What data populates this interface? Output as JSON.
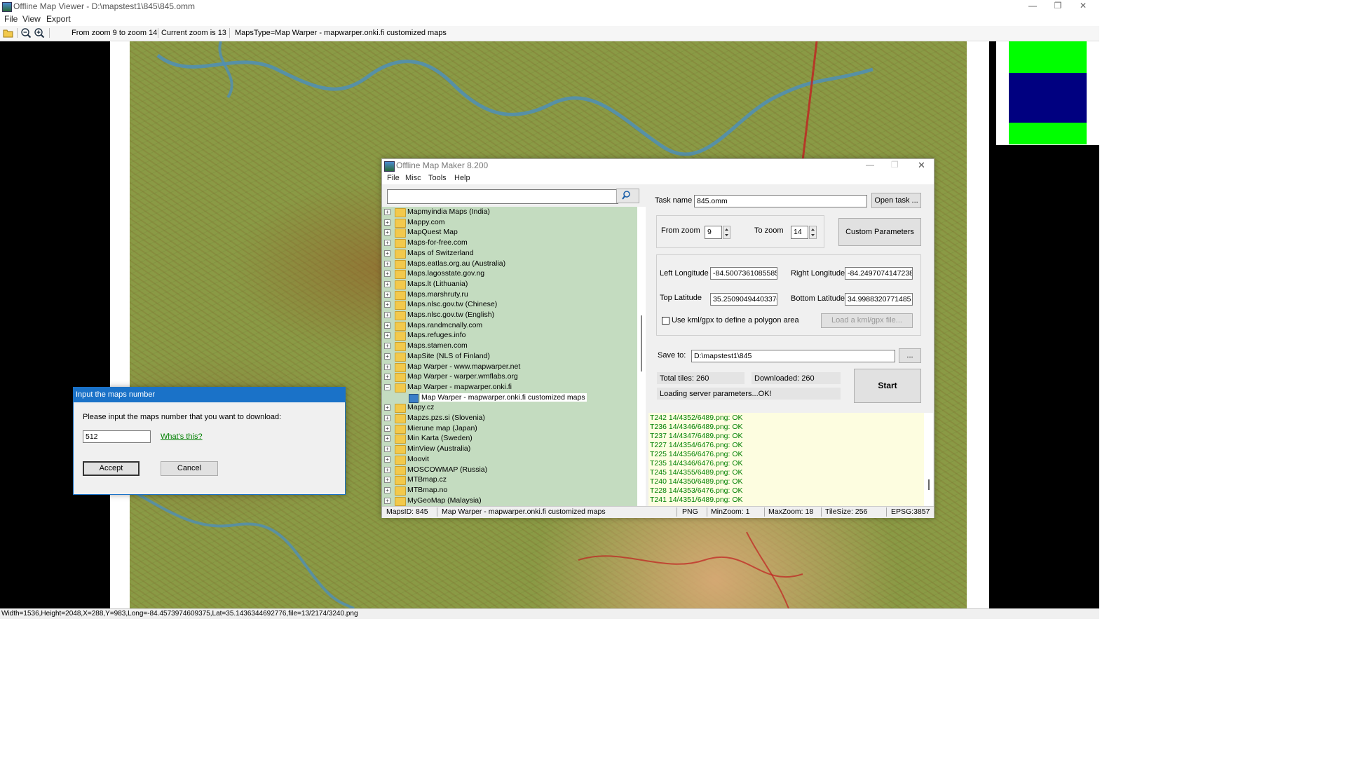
{
  "titlebar": {
    "title": "Offline Map Viewer - D:\\mapstest1\\845\\845.omm",
    "minimize": "—",
    "maximize": "❐",
    "close": "✕"
  },
  "menubar": {
    "items": [
      "File",
      "View",
      "Export"
    ]
  },
  "toolbar": {
    "icons": [
      "open-folder-icon",
      "zoom-out-icon",
      "zoom-in-icon"
    ],
    "zoom_range": "From zoom 9 to zoom 14",
    "current_zoom": "Current zoom is 13",
    "maps_type": "MapsType=Map Warper - mapwarper.onki.fi customized maps"
  },
  "statusbar": {
    "text": "Width=1536,Height=2048,X=288,Y=983,Long=-84.4573974609375,Lat=35.1436344692776,file=13/2174/3240.png"
  },
  "thumbnail": {
    "colors": [
      "#00ff00",
      "#000080",
      "#00ff00"
    ]
  },
  "omm": {
    "title": "Offline Map Maker 8.200",
    "menu": [
      "File",
      "Misc",
      "Tools",
      "Help"
    ],
    "search_placeholder": "",
    "tree": [
      {
        "label": "Mapmyindia Maps (India)",
        "expanded": false
      },
      {
        "label": "Mappy.com",
        "expanded": false
      },
      {
        "label": "MapQuest Map",
        "expanded": false
      },
      {
        "label": "Maps-for-free.com",
        "expanded": false
      },
      {
        "label": "Maps of Switzerland",
        "expanded": false
      },
      {
        "label": "Maps.eatlas.org.au (Australia)",
        "expanded": false
      },
      {
        "label": "Maps.lagosstate.gov.ng",
        "expanded": false
      },
      {
        "label": "Maps.lt (Lithuania)",
        "expanded": false
      },
      {
        "label": "Maps.marshruty.ru",
        "expanded": false
      },
      {
        "label": "Maps.nlsc.gov.tw (Chinese)",
        "expanded": false
      },
      {
        "label": "Maps.nlsc.gov.tw (English)",
        "expanded": false
      },
      {
        "label": "Maps.randmcnally.com",
        "expanded": false
      },
      {
        "label": "Maps.refuges.info",
        "expanded": false
      },
      {
        "label": "Maps.stamen.com",
        "expanded": false
      },
      {
        "label": "MapSite (NLS of Finland)",
        "expanded": false
      },
      {
        "label": "Map Warper - www.mapwarper.net",
        "expanded": false
      },
      {
        "label": "Map Warper - warper.wmflabs.org",
        "expanded": false
      },
      {
        "label": "Map Warper - mapwarper.onki.fi",
        "expanded": true
      },
      {
        "label": "Map Warper - mapwarper.onki.fi customized maps",
        "child": true
      },
      {
        "label": "Mapy.cz",
        "expanded": false
      },
      {
        "label": "Mapzs.pzs.si (Slovenia)",
        "expanded": false
      },
      {
        "label": "Mierune map (Japan)",
        "expanded": false
      },
      {
        "label": "Min Karta (Sweden)",
        "expanded": false
      },
      {
        "label": "MinView (Australia)",
        "expanded": false
      },
      {
        "label": "Moovit",
        "expanded": false
      },
      {
        "label": "MOSCOWMAP (Russia)",
        "expanded": false
      },
      {
        "label": "MTBmap.cz",
        "expanded": false
      },
      {
        "label": "MTBmap.no",
        "expanded": false
      },
      {
        "label": "MyGeoMap (Malaysia)",
        "expanded": false
      }
    ],
    "task_name_label": "Task name",
    "task_name_value": "845.omm",
    "open_task_label": "Open task ...",
    "from_zoom_label": "From zoom",
    "from_zoom_value": "9",
    "to_zoom_label": "To zoom",
    "to_zoom_value": "14",
    "custom_params_label": "Custom Parameters",
    "left_long_label": "Left Longitude",
    "left_long_value": "-84.5007361085585",
    "right_long_label": "Right Longitude",
    "right_long_value": "-84.2497074147238",
    "top_lat_label": "Top Latitude",
    "top_lat_value": "35.2509049440337€",
    "bottom_lat_label": "Bottom Latitude",
    "bottom_lat_value": "34.9988320771485",
    "kml_label": "Use kml/gpx to define a polygon area",
    "kml_checked": false,
    "load_kml_label": "Load a kml/gpx file...",
    "save_to_label": "Save to:",
    "save_to_value": "D:\\mapstest1\\845",
    "browse_label": "...",
    "total_tiles": "Total tiles: 260",
    "downloaded": "Downloaded: 260",
    "status_msg": "Loading server parameters...OK!",
    "start_label": "Start",
    "log": [
      "T242 14/4352/6489.png: OK",
      "T236 14/4346/6489.png: OK",
      "T237 14/4347/6489.png: OK",
      "T227 14/4354/6476.png: OK",
      "T225 14/4356/6476.png: OK",
      "T235 14/4346/6476.png: OK",
      "T245 14/4355/6489.png: OK",
      "T240 14/4350/6489.png: OK",
      "T228 14/4353/6476.png: OK",
      "T241 14/4351/6489.png: OK"
    ],
    "status": {
      "maps_id": "MapsID: 845",
      "maps_name": "Map Warper - mapwarper.onki.fi customized maps",
      "format": "PNG",
      "min_zoom": "MinZoom: 1",
      "max_zoom": "MaxZoom: 18",
      "tile_size": "TileSize: 256",
      "epsg": "EPSG:3857"
    }
  },
  "dialog": {
    "title": "Input the maps number",
    "prompt": "Please input the maps number that you want to download:",
    "input_value": "512",
    "whats_this": "What's this?",
    "accept_label": "Accept",
    "cancel_label": "Cancel"
  }
}
